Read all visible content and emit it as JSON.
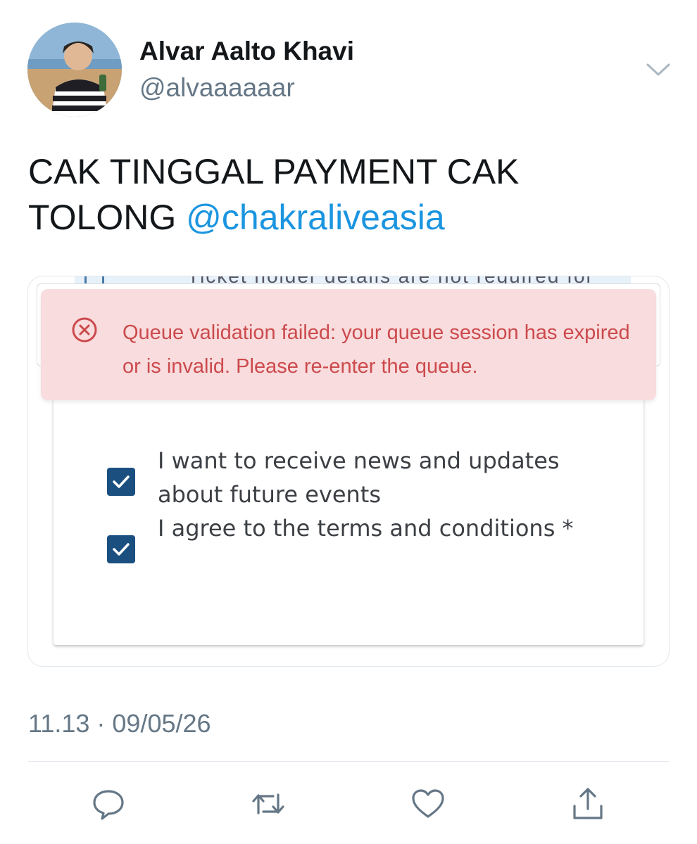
{
  "tweet": {
    "author": {
      "display_name": "Alvar Aalto Khavi",
      "handle": "@alvaaaaaar"
    },
    "text_lines": [
      "CAK TINGGAL PAYMENT CAK",
      "TOLONG "
    ],
    "mention": "@chakraliveasia",
    "timestamp": "11.13 · 09/05/26"
  },
  "screenshot": {
    "notice_cut_text": "Ticket holder details are not required for",
    "error_message": "Queue validation failed: your queue session has expired or is invalid. Please re-enter the queue.",
    "checkboxes": [
      {
        "label": "I want to receive news and updates about future events",
        "checked": true
      },
      {
        "label": "I agree to the terms and conditions *",
        "checked": true
      }
    ],
    "colors": {
      "error_bg": "#f9dcdd",
      "error_text": "#cc4a4d",
      "checkbox": "#1b4f80",
      "link": "#1b95e0"
    }
  },
  "actions": {
    "icons": [
      "reply-icon",
      "retweet-icon",
      "like-icon",
      "share-icon"
    ]
  }
}
